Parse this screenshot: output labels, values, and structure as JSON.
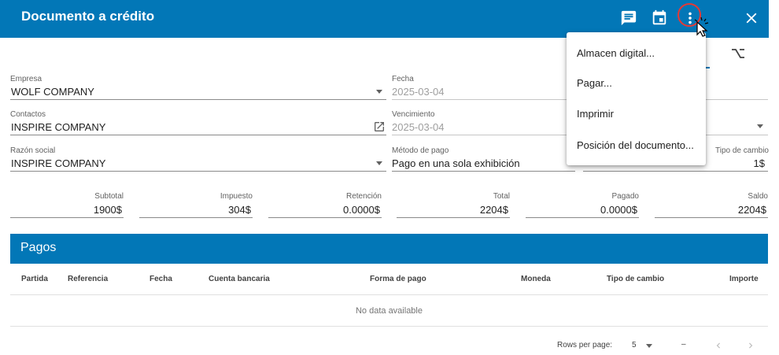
{
  "header": {
    "title": "Documento a crédito",
    "icons": [
      "comment-icon",
      "calendar-icon",
      "more-vert-icon",
      "close-icon"
    ]
  },
  "form": {
    "empresa": {
      "label": "Empresa",
      "value": "WOLF COMPANY"
    },
    "fecha": {
      "label": "Fecha",
      "value": "2025-03-04"
    },
    "contactos": {
      "label": "Contactos",
      "value": "INSPIRE COMPANY"
    },
    "vencimiento": {
      "label": "Vencimiento",
      "value": "2025-03-04"
    },
    "razon_social": {
      "label": "Razón social",
      "value": "INSPIRE COMPANY"
    },
    "metodo_pago": {
      "label": "Método de pago",
      "value": "Pago en una sola exhibición"
    },
    "tipo_cambio": {
      "label": "Tipo de cambio",
      "value": "1$"
    }
  },
  "summary": {
    "subtotal": {
      "label": "Subtotal",
      "value": "1900$"
    },
    "impuesto": {
      "label": "Impuesto",
      "value": "304$"
    },
    "retencion": {
      "label": "Retención",
      "value": "0.0000$"
    },
    "total": {
      "label": "Total",
      "value": "2204$"
    },
    "pagado": {
      "label": "Pagado",
      "value": "0.0000$"
    },
    "saldo": {
      "label": "Saldo",
      "value": "2204$"
    }
  },
  "pagos": {
    "title": "Pagos",
    "columns": [
      "Partida",
      "Referencia",
      "Fecha",
      "Cuenta bancaria",
      "Forma de pago",
      "Moneda",
      "Tipo de cambio",
      "Importe"
    ],
    "empty_text": "No data available",
    "rows_per_page_label": "Rows per page:",
    "rows_per_page": "5",
    "range_text": "–"
  },
  "menu": {
    "items": [
      "Almacen digital...",
      "Pagar...",
      "Imprimir",
      "Posición del documento..."
    ]
  },
  "colors": {
    "primary": "#0277b7",
    "highlight_ring": "#e53935"
  }
}
